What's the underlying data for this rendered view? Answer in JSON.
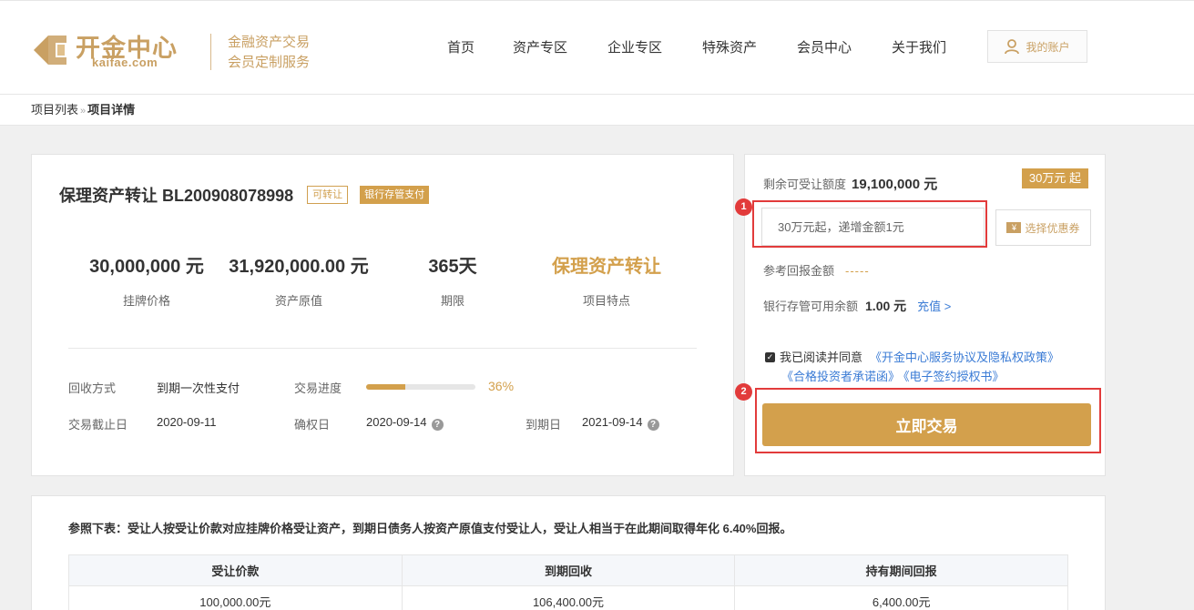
{
  "header": {
    "logo_cn": "开金中心",
    "logo_en": "kaifae.com",
    "slogan_1": "金融资产交易",
    "slogan_2": "会员定制服务",
    "nav": [
      "首页",
      "资产专区",
      "企业专区",
      "特殊资产",
      "会员中心",
      "关于我们"
    ],
    "account_label": "我的账户"
  },
  "breadcrumb": {
    "list": "项目列表",
    "sep": "»",
    "current": "项目详情"
  },
  "product": {
    "title": "保理资产转让 BL200908078998",
    "badge_transferable": "可转让",
    "badge_bank": "银行存管支付",
    "stats": [
      {
        "value": "30,000,000 元",
        "label": "挂牌价格"
      },
      {
        "value": "31,920,000.00 元",
        "label": "资产原值"
      },
      {
        "value": "365天",
        "label": "期限"
      },
      {
        "value": "保理资产转让",
        "label": "项目特点"
      }
    ],
    "repay_label": "回收方式",
    "repay_value": "到期一次性支付",
    "progress_label": "交易进度",
    "progress_percent": 36,
    "progress_text": "36%",
    "deadline_label": "交易截止日",
    "deadline_value": "2020-09-11",
    "confirm_label": "确权日",
    "confirm_value": "2020-09-14",
    "expire_label": "到期日",
    "expire_value": "2021-09-14",
    "help_glyph": "?"
  },
  "trade": {
    "remain_label": "剩余可受让额度",
    "remain_value": "19,100,000 元",
    "min_tag": "30万元 起",
    "amount_placeholder": "30万元起，递增金额1元",
    "coupon_label": "选择优惠券",
    "coupon_icon": "¥",
    "ref_return_label": "参考回报金额",
    "ref_return_value": "-----",
    "balance_label": "银行存管可用余额",
    "balance_value": "1.00 元",
    "recharge_label": "充值 >",
    "agree_text": "我已阅读并同意",
    "agreement_1": "《开金中心服务协议及隐私权政策》",
    "agreement_2": "《合格投资者承诺函》",
    "agreement_3": "《电子签约授权书》",
    "submit_label": "立即交易",
    "markers": [
      "1",
      "2"
    ]
  },
  "reference": {
    "note": "参照下表：受让人按受让价款对应挂牌价格受让资产，到期日债务人按资产原值支付受让人，受让人相当于在此期间取得年化 6.40%回报。",
    "headers": [
      "受让价款",
      "到期回收",
      "持有期间回报"
    ],
    "rows": [
      [
        "100,000.00元",
        "106,400.00元",
        "6,400.00元"
      ]
    ]
  },
  "colors": {
    "gold": "#d3a04c",
    "logo_gold": "#c9a063",
    "link_blue": "#3a7bd5",
    "annotation_red": "#e23b3b"
  },
  "icons": [
    "logo-mark-icon",
    "user-icon",
    "yen-icon",
    "help-icon",
    "checkbox-checked-icon"
  ]
}
